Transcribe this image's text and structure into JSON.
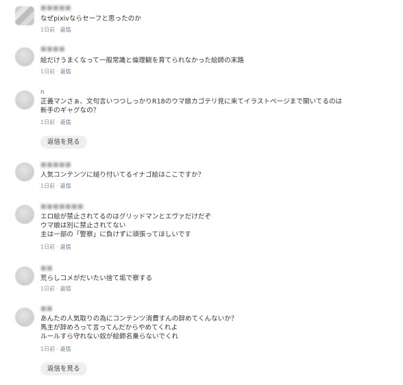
{
  "comments": [
    {
      "user": "■■■■■",
      "text": "なぜpixivならセーフと思ったのか",
      "time": "1日前",
      "reply": "返信"
    },
    {
      "user": "■■■■",
      "text": "絵だけうまくなって一般常識と倫理観を育てられなかった絵師の末路",
      "time": "1日前",
      "reply": "返信"
    },
    {
      "user": "n",
      "text": "正義マンさぁ、文句言いつつしっかりR18のウマ娘カゴテリ見に来てイラストページまで開いてるのは\n新手のギャグなの？",
      "time": "1日前",
      "reply": "返信",
      "view_replies": "返信を見る"
    },
    {
      "user": "■■■■■",
      "text": "人気コンテンツに縋り付いてるイナゴ絵はここですか？",
      "time": "1日前",
      "reply": "返信"
    },
    {
      "user": "■■■■■■■",
      "text": "エロ絵が禁止されてるのはグリッドマンとエヴァだけだぞ\nウマ娘は別に禁止されてない\n主は一部の「警察」に負けずに頑張ってほしいです",
      "time": "1日前",
      "reply": "返信"
    },
    {
      "user": "■■",
      "text": "荒らしコメがだいたい捨て垢で察する",
      "time": "1日前",
      "reply": "返信"
    },
    {
      "user": "■■",
      "text": "あんたの人気取りの為にコンテンツ消費すんの辞めてくんないか？\n馬主が辞めろって言ってんだからやめてくれよ\nルールすら守れない奴が絵師名乗らないでくれ",
      "time": "1日前",
      "reply": "返信",
      "view_replies": "返信を見る"
    }
  ],
  "meta_separator": " · "
}
